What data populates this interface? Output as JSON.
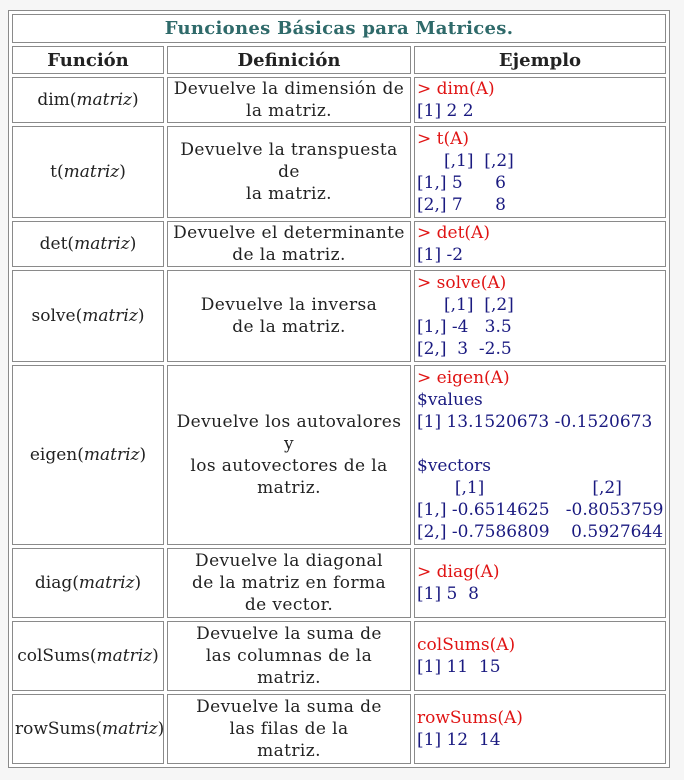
{
  "title": "Funciones Básicas para Matrices.",
  "headers": {
    "funcion": "Función",
    "definicion": "Definición",
    "ejemplo": "Ejemplo"
  },
  "rows": [
    {
      "fn_name": "dim(",
      "fn_arg": "matriz",
      "fn_close": ")",
      "definition": [
        "Devuelve la dimensión de",
        "la matriz."
      ],
      "example": [
        {
          "text": "> dim(A)",
          "cmd": true
        },
        {
          "text": "[1] 2 2",
          "cmd": false
        }
      ]
    },
    {
      "fn_name": "t(",
      "fn_arg": "matriz",
      "fn_close": ")",
      "definition": [
        "Devuelve la transpuesta de",
        "la matriz."
      ],
      "example": [
        {
          "text": "> t(A)",
          "cmd": true
        },
        {
          "text": "     [,1]  [,2]",
          "cmd": false
        },
        {
          "text": "[1,] 5      6",
          "cmd": false
        },
        {
          "text": "[2,] 7      8",
          "cmd": false
        }
      ]
    },
    {
      "fn_name": "det(",
      "fn_arg": "matriz",
      "fn_close": ")",
      "definition": [
        "Devuelve el determinante",
        "de la matriz."
      ],
      "example": [
        {
          "text": "> det(A)",
          "cmd": true
        },
        {
          "text": "[1] -2",
          "cmd": false
        }
      ]
    },
    {
      "fn_name": "solve(",
      "fn_arg": "matriz",
      "fn_close": ")",
      "definition": [
        "Devuelve la inversa",
        "de la matriz."
      ],
      "example": [
        {
          "text": "> solve(A)",
          "cmd": true
        },
        {
          "text": "     [,1]  [,2]",
          "cmd": false
        },
        {
          "text": "[1,] -4   3.5",
          "cmd": false
        },
        {
          "text": "[2,]  3  -2.5",
          "cmd": false
        }
      ]
    },
    {
      "fn_name": "eigen(",
      "fn_arg": "matriz",
      "fn_close": ")",
      "definition": [
        "Devuelve los autovalores y",
        "los autovectores de la",
        "matriz."
      ],
      "example": [
        {
          "text": "> eigen(A)",
          "cmd": true
        },
        {
          "text": "$values",
          "cmd": false
        },
        {
          "text": "[1] 13.1520673 -0.1520673",
          "cmd": false
        },
        {
          "text": "",
          "cmd": false
        },
        {
          "text": "$vectors",
          "cmd": false
        },
        {
          "text": "       [,1]                    [,2]",
          "cmd": false
        },
        {
          "text": "[1,] -0.6514625   -0.8053759",
          "cmd": false
        },
        {
          "text": "[2,] -0.7586809    0.5927644",
          "cmd": false
        }
      ]
    },
    {
      "fn_name": "diag(",
      "fn_arg": "matriz",
      "fn_close": ")",
      "definition": [
        "Devuelve la diagonal",
        "de la matriz en forma",
        "de vector."
      ],
      "example": [
        {
          "text": "> diag(A)",
          "cmd": true
        },
        {
          "text": "[1] 5  8",
          "cmd": false
        }
      ]
    },
    {
      "fn_name": "colSums(",
      "fn_arg": "matriz",
      "fn_close": ")",
      "definition": [
        "Devuelve la suma de",
        "las columnas de la",
        "matriz."
      ],
      "example": [
        {
          "text": "colSums(A)",
          "cmd": true
        },
        {
          "text": "[1] 11  15",
          "cmd": false
        }
      ]
    },
    {
      "fn_name": "rowSums(",
      "fn_arg": "matriz",
      "fn_close": ")",
      "definition": [
        "Devuelve la suma de",
        "las filas de la",
        "matriz."
      ],
      "example": [
        {
          "text": "rowSums(A)",
          "cmd": true
        },
        {
          "text": "[1] 12  14",
          "cmd": false
        }
      ]
    }
  ],
  "colors": {
    "title": "#2f6a6a",
    "command": "#e01414",
    "output": "#1a1a80"
  }
}
